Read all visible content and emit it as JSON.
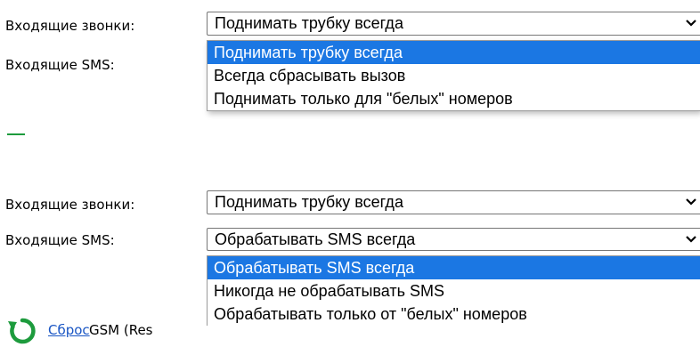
{
  "form1": {
    "calls_label": "Входящие звонки:",
    "sms_label": "Входящие SMS:",
    "calls_select": {
      "value": "Поднимать трубку всегда",
      "open": true,
      "options": [
        "Поднимать трубку всегда",
        "Всегда сбрасывать вызов",
        "Поднимать только для \"белых\" номеров"
      ],
      "highlighted_index": 0
    }
  },
  "form2": {
    "calls_label": "Входящие звонки:",
    "sms_label": "Входящие SMS:",
    "calls_select": {
      "value": "Поднимать трубку всегда"
    },
    "sms_select": {
      "value": "Обрабатывать SMS всегда",
      "open": true,
      "options": [
        "Обрабатывать SMS всегда",
        "Никогда не обрабатывать SMS",
        "Обрабатывать только от \"белых\" номеров"
      ],
      "highlighted_index": 0
    }
  },
  "reset": {
    "link_text": "Сброс",
    "rest_text": "GSM (Res"
  },
  "colors": {
    "highlight": "#1b77e3",
    "link": "#1a56c4",
    "refresh_icon": "#1d9b3d"
  },
  "icons": [
    "chevron-down-icon",
    "refresh-icon"
  ]
}
